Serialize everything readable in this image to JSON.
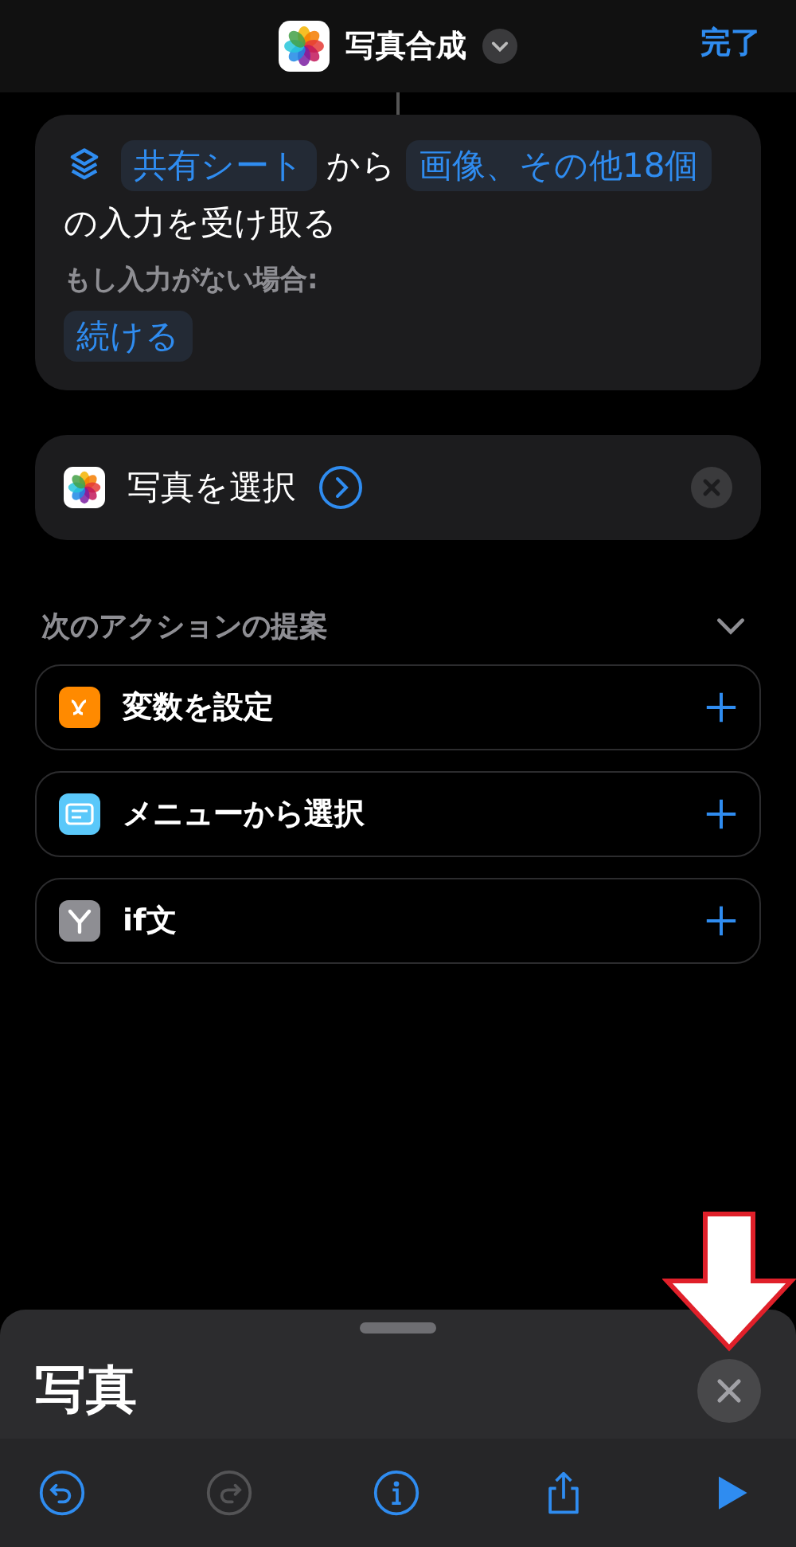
{
  "header": {
    "title": "写真合成",
    "done": "完了"
  },
  "receive_action": {
    "parts": [
      {
        "kind": "token",
        "text": "共有シート"
      },
      {
        "kind": "text",
        "text": "から"
      },
      {
        "kind": "token",
        "text": "画像、その他18個"
      },
      {
        "kind": "text",
        "text": "の入力を受け取る"
      }
    ],
    "fallback_label": "もし入力がない場合:",
    "fallback_value": "続ける"
  },
  "select_action": {
    "title": "写真を選択"
  },
  "suggestions": {
    "title": "次のアクションの提案",
    "expanded": true,
    "items": [
      {
        "label": "変数を設定",
        "kind": "variable"
      },
      {
        "label": "メニューから選択",
        "kind": "menu"
      },
      {
        "label": "if文",
        "kind": "if"
      }
    ]
  },
  "sheet": {
    "title": "写真"
  },
  "toolbar": [
    {
      "kind": "undo",
      "disabled": false
    },
    {
      "kind": "redo",
      "disabled": true
    },
    {
      "kind": "info",
      "disabled": false
    },
    {
      "kind": "share",
      "disabled": false
    },
    {
      "kind": "run",
      "disabled": false
    }
  ]
}
